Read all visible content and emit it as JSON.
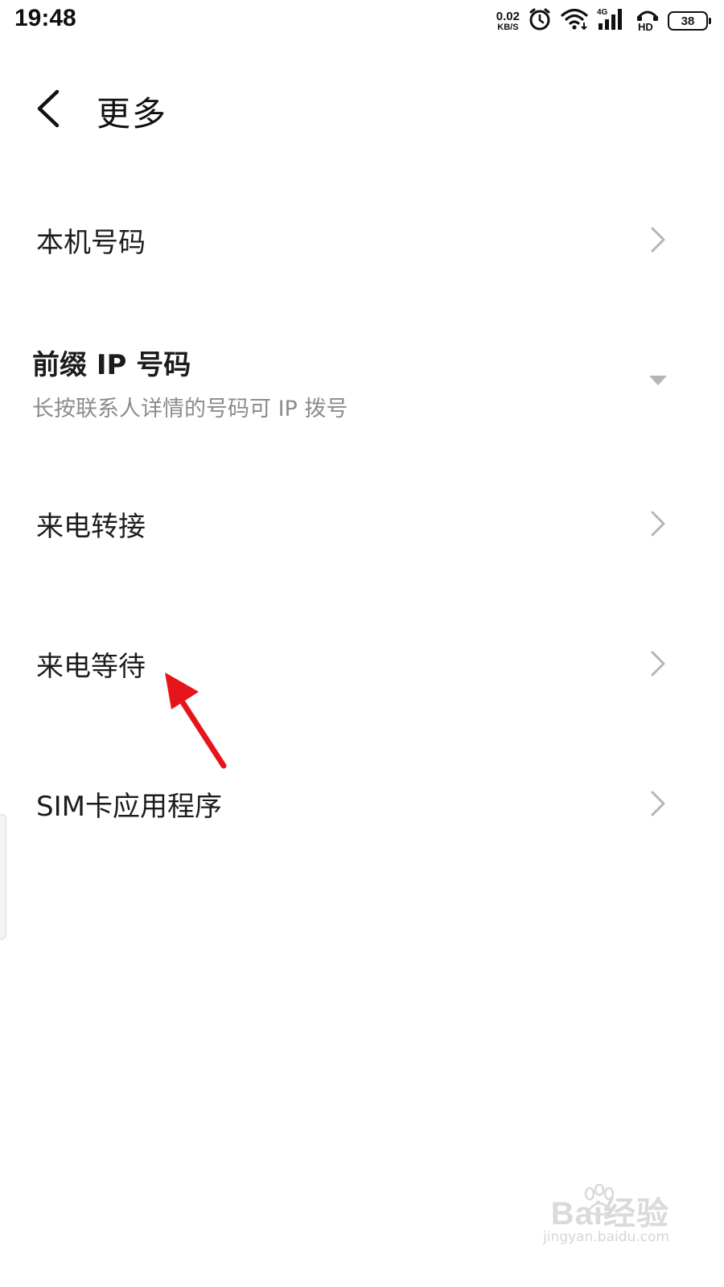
{
  "status_bar": {
    "time": "19:48",
    "net_speed_value": "0.02",
    "net_speed_unit": "KB/S",
    "battery_level": "38",
    "icons": [
      "alarm-icon",
      "wifi-icon",
      "signal-4g-icon",
      "hd-call-icon",
      "battery-icon"
    ]
  },
  "header": {
    "title": "更多"
  },
  "list": {
    "items": [
      {
        "label": "本机号码",
        "type": "chevron"
      },
      {
        "label": "前缀 IP 号码",
        "subtitle": "长按联系人详情的号码可 IP 拨号",
        "type": "dropdown"
      },
      {
        "label": "来电转接",
        "type": "chevron"
      },
      {
        "label": "来电等待",
        "type": "chevron"
      },
      {
        "label": "SIM卡应用程序",
        "type": "chevron"
      }
    ]
  },
  "watermark": {
    "brand": "Bai经验",
    "url": "jingyan.baidu.com"
  },
  "colors": {
    "annotation_arrow": "#e8141c",
    "chevron": "#b5b5b5",
    "subtitle": "#8c8c8c"
  }
}
